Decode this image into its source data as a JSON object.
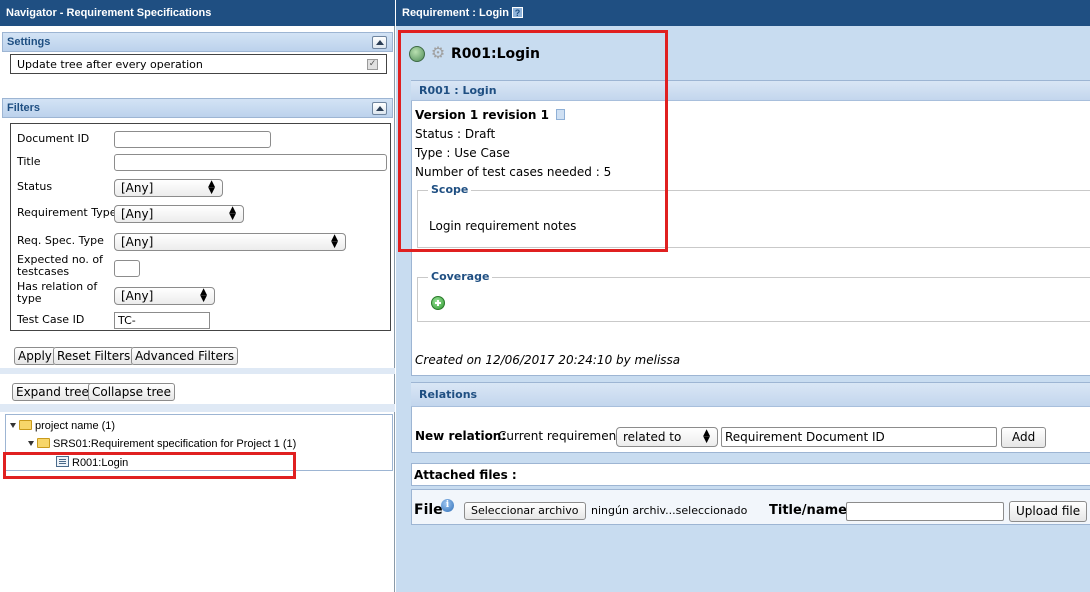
{
  "left": {
    "title": "Navigator - Requirement Specifications",
    "settings": {
      "header": "Settings",
      "update_tree_label": "Update tree after every operation",
      "update_tree_checked": true
    },
    "filters": {
      "header": "Filters",
      "document_id_label": "Document ID",
      "document_id_value": "",
      "title_label": "Title",
      "title_value": "",
      "status_label": "Status",
      "status_value": "[Any]",
      "req_type_label": "Requirement Type",
      "req_type_value": "[Any]",
      "req_spec_type_label": "Req. Spec. Type",
      "req_spec_type_value": "[Any]",
      "expected_tc_label_1": "Expected no. of",
      "expected_tc_label_2": "testcases",
      "expected_tc_value": "",
      "has_relation_label_1": "Has relation of",
      "has_relation_label_2": "type",
      "has_relation_value": "[Any]",
      "test_case_id_label": "Test Case ID",
      "test_case_id_value": "TC-",
      "apply_label": "Apply",
      "reset_label": "Reset Filters",
      "advanced_label": "Advanced Filters"
    },
    "tree": {
      "expand_label": "Expand tree",
      "collapse_label": "Collapse tree",
      "project": "project name (1)",
      "spec": "SRS01:Requirement specification for Project 1 (1)",
      "requirement": "R001:Login"
    }
  },
  "right": {
    "title": "Requirement : Login",
    "help_glyph": "?",
    "heading": "R001:Login",
    "details": {
      "header": "R001 : Login",
      "version": "Version 1 revision 1",
      "status": "Status : Draft",
      "type": "Type : Use Case",
      "tc_needed": "Number of test cases needed : 5",
      "scope_legend": "Scope",
      "scope_text": "Login requirement notes",
      "coverage_legend": "Coverage",
      "created": "Created on 12/06/2017 20:24:10  by melissa"
    },
    "relations": {
      "header": "Relations",
      "new_relation_label": "New relation:",
      "current_req": "Current requirement",
      "relation_type": "related to",
      "doc_id_value": "Requirement Document ID",
      "add_label": "Add"
    },
    "attachments": {
      "header": "Attached files :",
      "file_label": "File",
      "info_glyph": "i",
      "choose_label": "Seleccionar archivo",
      "no_file": "ningún archiv...seleccionado",
      "title_name_label": "Title/name:",
      "title_name_value": "",
      "upload_label": "Upload file"
    }
  },
  "colors": {
    "title_bar": "#1f4f82",
    "right_background": "#c8dcf0",
    "highlight_red": "#e02020"
  },
  "icons": [
    "collapse-icon",
    "folder-icon",
    "requirement-icon",
    "help-icon",
    "globe-icon",
    "gear-icon",
    "add-coverage-icon",
    "info-icon",
    "expand-triangle-icon"
  ]
}
